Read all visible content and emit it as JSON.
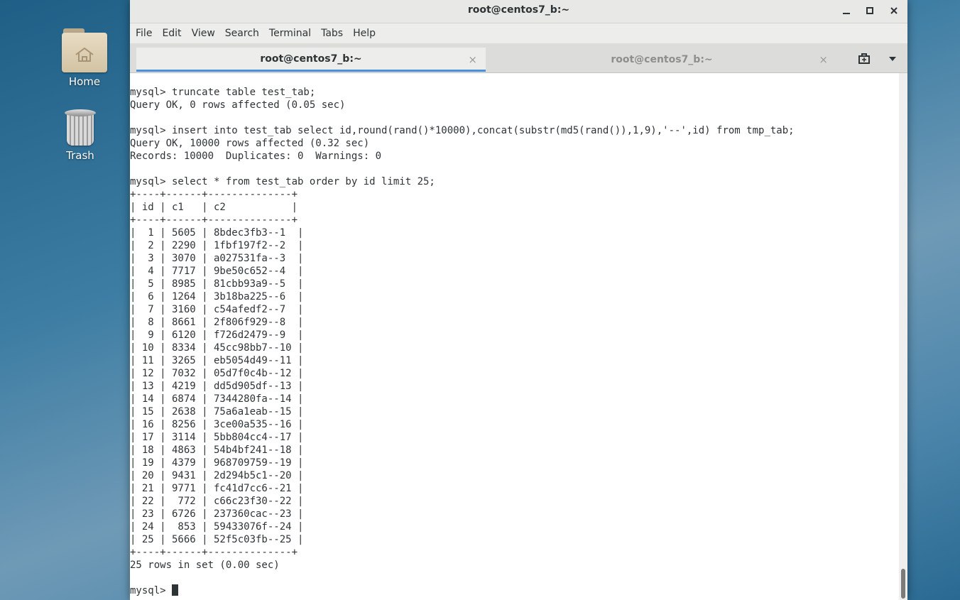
{
  "desktop": {
    "icons": [
      {
        "label": "Home"
      },
      {
        "label": "Trash"
      }
    ]
  },
  "window": {
    "title": "root@centos7_b:~",
    "menu": [
      "File",
      "Edit",
      "View",
      "Search",
      "Terminal",
      "Tabs",
      "Help"
    ],
    "tabs": [
      {
        "label": "root@centos7_b:~",
        "active": true
      },
      {
        "label": "root@centos7_b:~",
        "active": false
      }
    ]
  },
  "terminal": {
    "lines": [
      "",
      "mysql> truncate table test_tab;",
      "Query OK, 0 rows affected (0.05 sec)",
      "",
      "mysql> insert into test_tab select id,round(rand()*10000),concat(substr(md5(rand()),1,9),'--',id) from tmp_tab;",
      "Query OK, 10000 rows affected (0.32 sec)",
      "Records: 10000  Duplicates: 0  Warnings: 0",
      "",
      "mysql> select * from test_tab order by id limit 25;",
      "+----+------+--------------+",
      "| id | c1   | c2           |",
      "+----+------+--------------+",
      "|  1 | 5605 | 8bdec3fb3--1  |",
      "|  2 | 2290 | 1fbf197f2--2  |",
      "|  3 | 3070 | a027531fa--3  |",
      "|  4 | 7717 | 9be50c652--4  |",
      "|  5 | 8985 | 81cbb93a9--5  |",
      "|  6 | 1264 | 3b18ba225--6  |",
      "|  7 | 3160 | c54afedf2--7  |",
      "|  8 | 8661 | 2f806f929--8  |",
      "|  9 | 6120 | f726d2479--9  |",
      "| 10 | 8334 | 45cc98bb7--10 |",
      "| 11 | 3265 | eb5054d49--11 |",
      "| 12 | 7032 | 05d7f0c4b--12 |",
      "| 13 | 4219 | dd5d905df--13 |",
      "| 14 | 6874 | 7344280fa--14 |",
      "| 15 | 2638 | 75a6a1eab--15 |",
      "| 16 | 8256 | 3ce00a535--16 |",
      "| 17 | 3114 | 5bb804cc4--17 |",
      "| 18 | 4863 | 54b4bf241--18 |",
      "| 19 | 4379 | 968709759--19 |",
      "| 20 | 9431 | 2d294b5c1--20 |",
      "| 21 | 9771 | fc41d7cc6--21 |",
      "| 22 |  772 | c66c23f30--22 |",
      "| 23 | 6726 | 237360cac--23 |",
      "| 24 |  853 | 59433076f--24 |",
      "| 25 | 5666 | 52f5c03fb--25 |",
      "+----+------+--------------+",
      "25 rows in set (0.00 sec)",
      ""
    ],
    "prompt": "mysql> "
  }
}
